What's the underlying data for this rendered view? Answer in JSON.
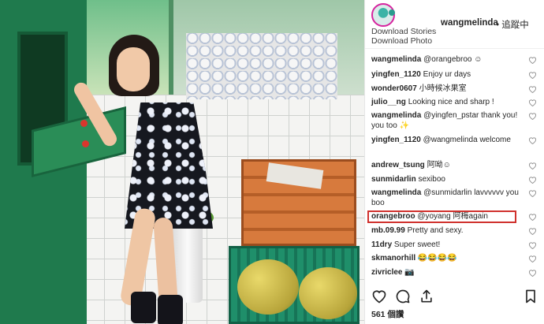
{
  "post": {
    "header": {
      "username": "wangmelinda",
      "follow_label": "• 追蹤中",
      "download_stories": "Download Stories",
      "download_photo": "Download Photo"
    },
    "comments": [
      {
        "user": "wangmelinda",
        "text": "@orangebroo ☺"
      },
      {
        "user": "yingfen_1120",
        "text": "Enjoy ur days"
      },
      {
        "user": "wonder0607",
        "text": "小時候冰果室"
      },
      {
        "user": "julio__ng",
        "text": "Looking nice and sharp !"
      },
      {
        "user": "wangmelinda",
        "text": "@yingfen_pstar thank you! you too ✨"
      },
      {
        "user": "yingfen_1120",
        "text": "@wangmelinda welcome"
      },
      {
        "user": "andrew_tsung",
        "text": "阿呦☺"
      },
      {
        "user": "sunmidarlin",
        "text": "sexiboo"
      },
      {
        "user": "wangmelinda",
        "text": "@sunmidarlin lavvvvvv you boo"
      },
      {
        "user": "orangebroo",
        "text": "@yoyang 阿梅again"
      },
      {
        "user": "mb.09.99",
        "text": "Pretty and sexy."
      },
      {
        "user": "11dry",
        "text": "Super sweet!"
      },
      {
        "user": "skmanorhill",
        "text": "😂😂😂😂"
      },
      {
        "user": "zivriclee",
        "text": "📷"
      }
    ],
    "likes_text": "561 個讚",
    "icons": {
      "like": "heart-icon",
      "comment": "comment-icon",
      "share": "share-icon",
      "save": "bookmark-icon"
    },
    "colors": {
      "highlight_border": "#d0312d",
      "story_ring": "#d6249f"
    }
  }
}
